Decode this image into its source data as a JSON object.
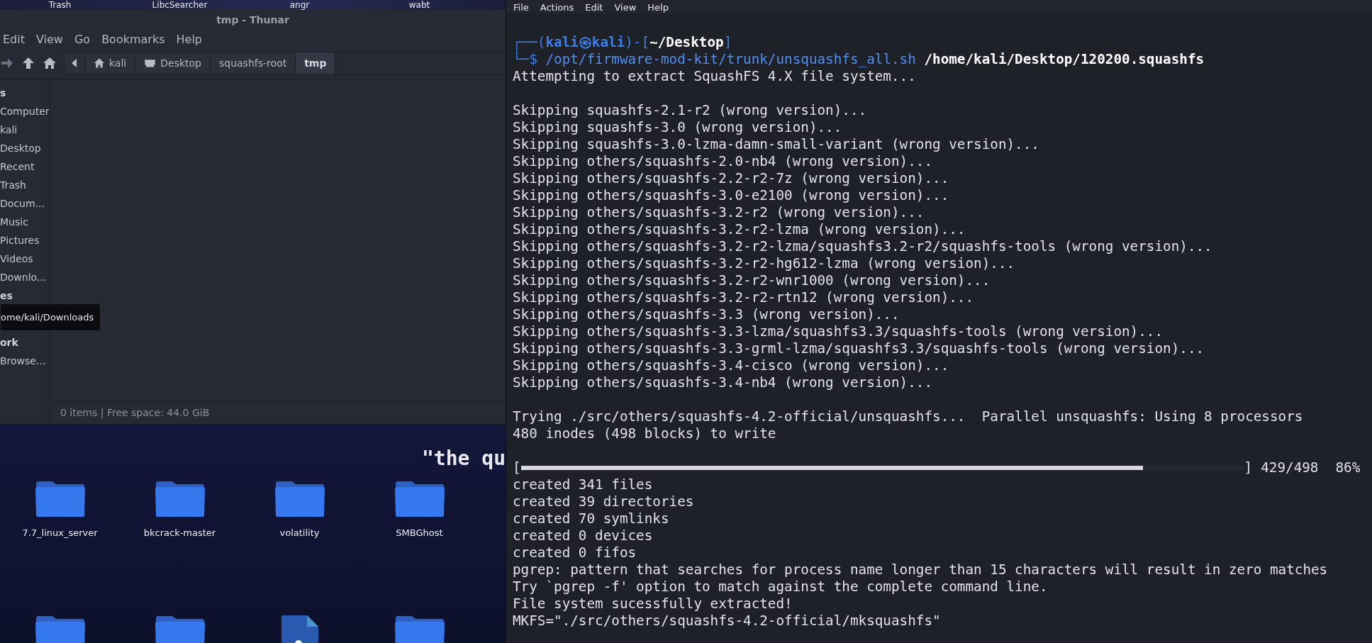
{
  "desktop": {
    "top_icons": [
      {
        "label": "Trash"
      },
      {
        "label": "LibcSearcher"
      },
      {
        "label": "angr"
      },
      {
        "label": "wabt"
      }
    ],
    "quote": "\"the qu",
    "icons": [
      {
        "kind": "folder",
        "label": "7.7_linux_server"
      },
      {
        "kind": "folder",
        "label": "bkcrack-master"
      },
      {
        "kind": "folder",
        "label": "volatility"
      },
      {
        "kind": "folder",
        "label": "SMBGhost"
      },
      {
        "kind": "folder"
      },
      {
        "kind": "folder"
      },
      {
        "kind": "file"
      },
      {
        "kind": "folder"
      }
    ]
  },
  "file_manager": {
    "title": "tmp - Thunar",
    "menu": [
      "Edit",
      "View",
      "Go",
      "Bookmarks",
      "Help"
    ],
    "path": [
      {
        "label": "kali",
        "kind": "home",
        "selected": false
      },
      {
        "label": "Desktop",
        "kind": "drive",
        "selected": false
      },
      {
        "label": "squashfs-root",
        "kind": "folder",
        "selected": false
      },
      {
        "label": "tmp",
        "kind": "folder",
        "selected": true
      }
    ],
    "sidebar": [
      {
        "kind": "header",
        "label": "s"
      },
      {
        "kind": "item",
        "label": "Computer"
      },
      {
        "kind": "item",
        "label": "kali"
      },
      {
        "kind": "item",
        "label": "Desktop"
      },
      {
        "kind": "item",
        "label": "Recent"
      },
      {
        "kind": "item",
        "label": "Trash"
      },
      {
        "kind": "item",
        "label": "Docum..."
      },
      {
        "kind": "item",
        "label": "Music"
      },
      {
        "kind": "item",
        "label": "Pictures"
      },
      {
        "kind": "item",
        "label": "Videos"
      },
      {
        "kind": "item",
        "label": "Downlo..."
      },
      {
        "kind": "header",
        "label": "es"
      },
      {
        "kind": "hidden"
      },
      {
        "kind": "header",
        "label": "ork"
      },
      {
        "kind": "item",
        "label": "Browse..."
      }
    ],
    "tooltip": "ome/kali/Downloads",
    "status": "0 items | Free space: 44.0 GiB"
  },
  "terminal": {
    "menu": [
      "File",
      "Actions",
      "Edit",
      "View",
      "Help"
    ],
    "lines": [
      {
        "kind": "blank"
      },
      {
        "kind": "prompt",
        "segments": [
          {
            "kind": "frame",
            "text": "┌──("
          },
          {
            "kind": "user",
            "text": "kali㉿kali"
          },
          {
            "kind": "frame",
            "text": ")-["
          },
          {
            "kind": "path",
            "text": "~/Desktop"
          },
          {
            "kind": "frame",
            "text": "]"
          }
        ]
      },
      {
        "kind": "prompt",
        "segments": [
          {
            "kind": "frame",
            "text": "└─$ "
          },
          {
            "kind": "command",
            "text": "/opt/firmware-mod-kit/trunk/unsquashfs_all.sh "
          },
          {
            "kind": "path",
            "text": "/home/kali/Desktop/120200.squashfs"
          }
        ]
      },
      {
        "kind": "text",
        "text": "Attempting to extract SquashFS 4.X file system..."
      },
      {
        "kind": "blank"
      },
      {
        "kind": "text",
        "text": "Skipping squashfs-2.1-r2 (wrong version)..."
      },
      {
        "kind": "text",
        "text": "Skipping squashfs-3.0 (wrong version)..."
      },
      {
        "kind": "text",
        "text": "Skipping squashfs-3.0-lzma-damn-small-variant (wrong version)..."
      },
      {
        "kind": "text",
        "text": "Skipping others/squashfs-2.0-nb4 (wrong version)..."
      },
      {
        "kind": "text",
        "text": "Skipping others/squashfs-2.2-r2-7z (wrong version)..."
      },
      {
        "kind": "text",
        "text": "Skipping others/squashfs-3.0-e2100 (wrong version)..."
      },
      {
        "kind": "text",
        "text": "Skipping others/squashfs-3.2-r2 (wrong version)..."
      },
      {
        "kind": "text",
        "text": "Skipping others/squashfs-3.2-r2-lzma (wrong version)..."
      },
      {
        "kind": "text",
        "text": "Skipping others/squashfs-3.2-r2-lzma/squashfs3.2-r2/squashfs-tools (wrong version)..."
      },
      {
        "kind": "text",
        "text": "Skipping others/squashfs-3.2-r2-hg612-lzma (wrong version)..."
      },
      {
        "kind": "text",
        "text": "Skipping others/squashfs-3.2-r2-wnr1000 (wrong version)..."
      },
      {
        "kind": "text",
        "text": "Skipping others/squashfs-3.2-r2-rtn12 (wrong version)..."
      },
      {
        "kind": "text",
        "text": "Skipping others/squashfs-3.3 (wrong version)..."
      },
      {
        "kind": "text",
        "text": "Skipping others/squashfs-3.3-lzma/squashfs3.3/squashfs-tools (wrong version)..."
      },
      {
        "kind": "text",
        "text": "Skipping others/squashfs-3.3-grml-lzma/squashfs3.3/squashfs-tools (wrong version)..."
      },
      {
        "kind": "text",
        "text": "Skipping others/squashfs-3.4-cisco (wrong version)..."
      },
      {
        "kind": "text",
        "text": "Skipping others/squashfs-3.4-nb4 (wrong version)..."
      },
      {
        "kind": "blank"
      },
      {
        "kind": "text",
        "text": "Trying ./src/others/squashfs-4.2-official/unsquashfs...  Parallel unsquashfs: Using 8 processors"
      },
      {
        "kind": "text",
        "text": "480 inodes (498 blocks) to write"
      },
      {
        "kind": "blank"
      },
      {
        "kind": "progress",
        "open": "[",
        "close": "]",
        "level": 0.86,
        "count": "429/498",
        "percent": "86%"
      },
      {
        "kind": "text",
        "text": "created 341 files"
      },
      {
        "kind": "text",
        "text": "created 39 directories"
      },
      {
        "kind": "text",
        "text": "created 70 symlinks"
      },
      {
        "kind": "text",
        "text": "created 0 devices"
      },
      {
        "kind": "text",
        "text": "created 0 fifos"
      },
      {
        "kind": "text",
        "text": "pgrep: pattern that searches for process name longer than 15 characters will result in zero matches"
      },
      {
        "kind": "text",
        "text": "Try `pgrep -f' option to match against the complete command line."
      },
      {
        "kind": "text",
        "text": "File system sucessfully extracted!"
      },
      {
        "kind": "text",
        "text": "MKFS=\"./src/others/squashfs-4.2-official/mksquashfs\""
      }
    ]
  }
}
